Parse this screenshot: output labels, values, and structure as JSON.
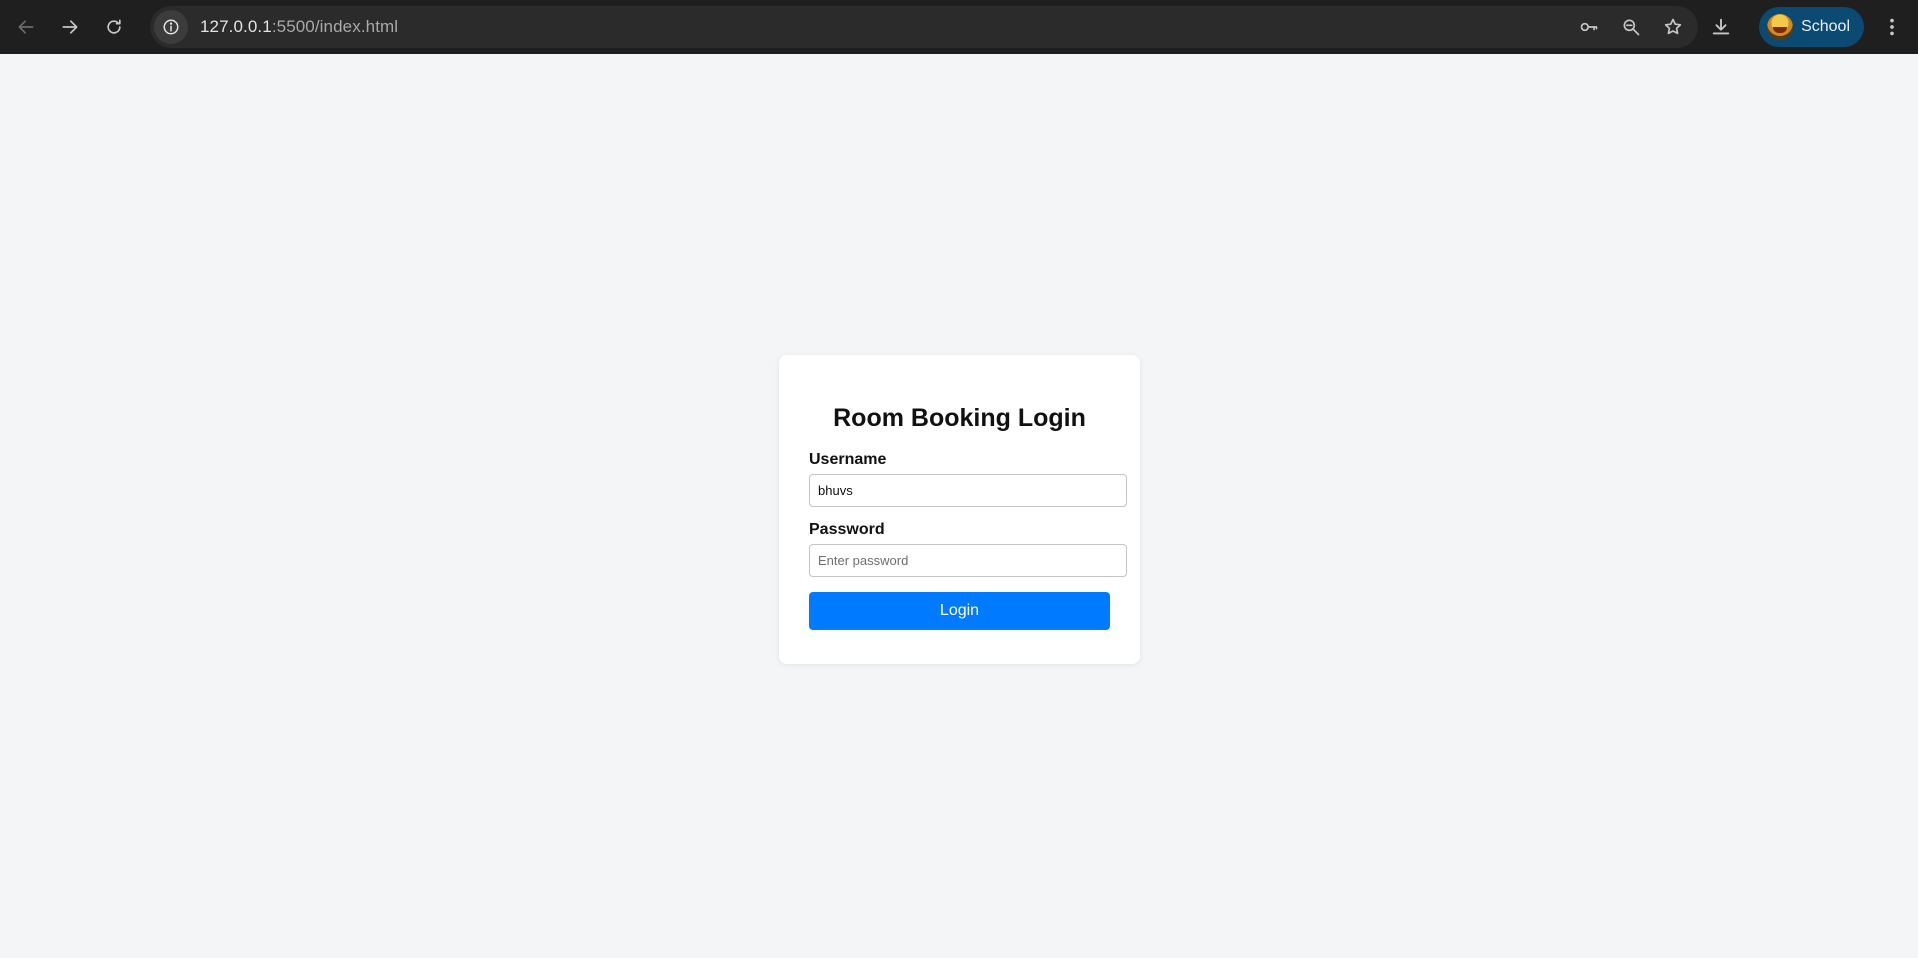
{
  "browser": {
    "url_host": "127.0.0.1",
    "url_rest": ":5500/index.html",
    "profile_label": "School"
  },
  "login": {
    "title": "Room Booking Login",
    "username_label": "Username",
    "username_value": "bhuvs",
    "password_label": "Password",
    "password_placeholder": "Enter password",
    "password_value": "",
    "button_label": "Login"
  },
  "colors": {
    "accent": "#007bff",
    "page_background": "#f4f5f7",
    "card_background": "#ffffff"
  }
}
